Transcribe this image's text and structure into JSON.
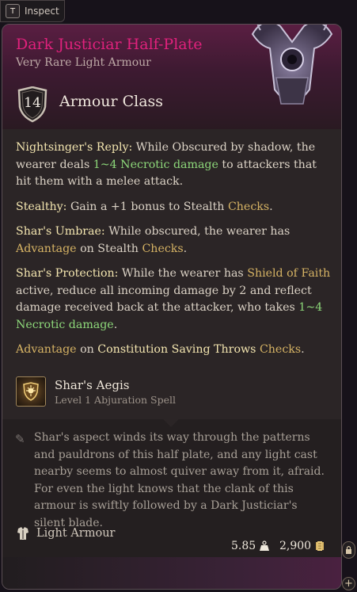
{
  "inspect": {
    "key": "T",
    "label": "Inspect"
  },
  "item": {
    "name": "Dark Justiciar Half-Plate",
    "rarity_type": "Very Rare Light Armour",
    "name_color": "#e0217c"
  },
  "armour_class": {
    "value": "14",
    "label": "Armour Class"
  },
  "properties": {
    "p1": {
      "name": "Nightsinger's Reply:",
      "text1": " While Obscured by shadow, the wearer deals ",
      "damage": "1~4 Necrotic damage",
      "text2": " to attackers that hit them with a melee attack."
    },
    "p2": {
      "name": "Stealthy:",
      "text1": " Gain a +1 bonus to Stealth ",
      "checks": "Checks",
      "end": "."
    },
    "p3": {
      "name": "Shar's Umbrae:",
      "text1": " While obscured, the wearer has ",
      "advantage": "Advantage",
      "text2": " on Stealth ",
      "checks": "Checks",
      "end": "."
    },
    "p4": {
      "name": "Shar's Protection:",
      "text1": " While the wearer has ",
      "shield": "Shield of Faith",
      "text2": " active, reduce all incoming damage by 2 and reflect damage received back at the attacker, who takes ",
      "damage": "1~4 Necrotic damage",
      "end": "."
    },
    "p5": {
      "advantage": "Advantage",
      "text1": " on ",
      "save": "Constitution Saving Throws",
      "text2": " ",
      "checks": "Checks",
      "end": "."
    }
  },
  "spell": {
    "name": "Shar's Aegis",
    "level_school": "Level 1 Abjuration Spell",
    "icon": "sun-shield-icon"
  },
  "description": "Shar's aspect winds its way through the patterns and pauldrons of this half plate, and any light cast nearby seems to almost quiver away from it, afraid. For even the light knows that the clank of this armour is swiftly followed by a Dark Justiciar's silent blade.",
  "armour_type": {
    "label": "Light Armour",
    "icon": "chest-armour-icon"
  },
  "footer": {
    "weight": "5.85",
    "weight_icon": "weight-icon",
    "value": "2,900",
    "value_icon": "gold-coin-icon"
  },
  "colors": {
    "accent_gold": "#d6b364",
    "damage_green": "#8dd87a",
    "keyword": "#f4e6b0"
  }
}
